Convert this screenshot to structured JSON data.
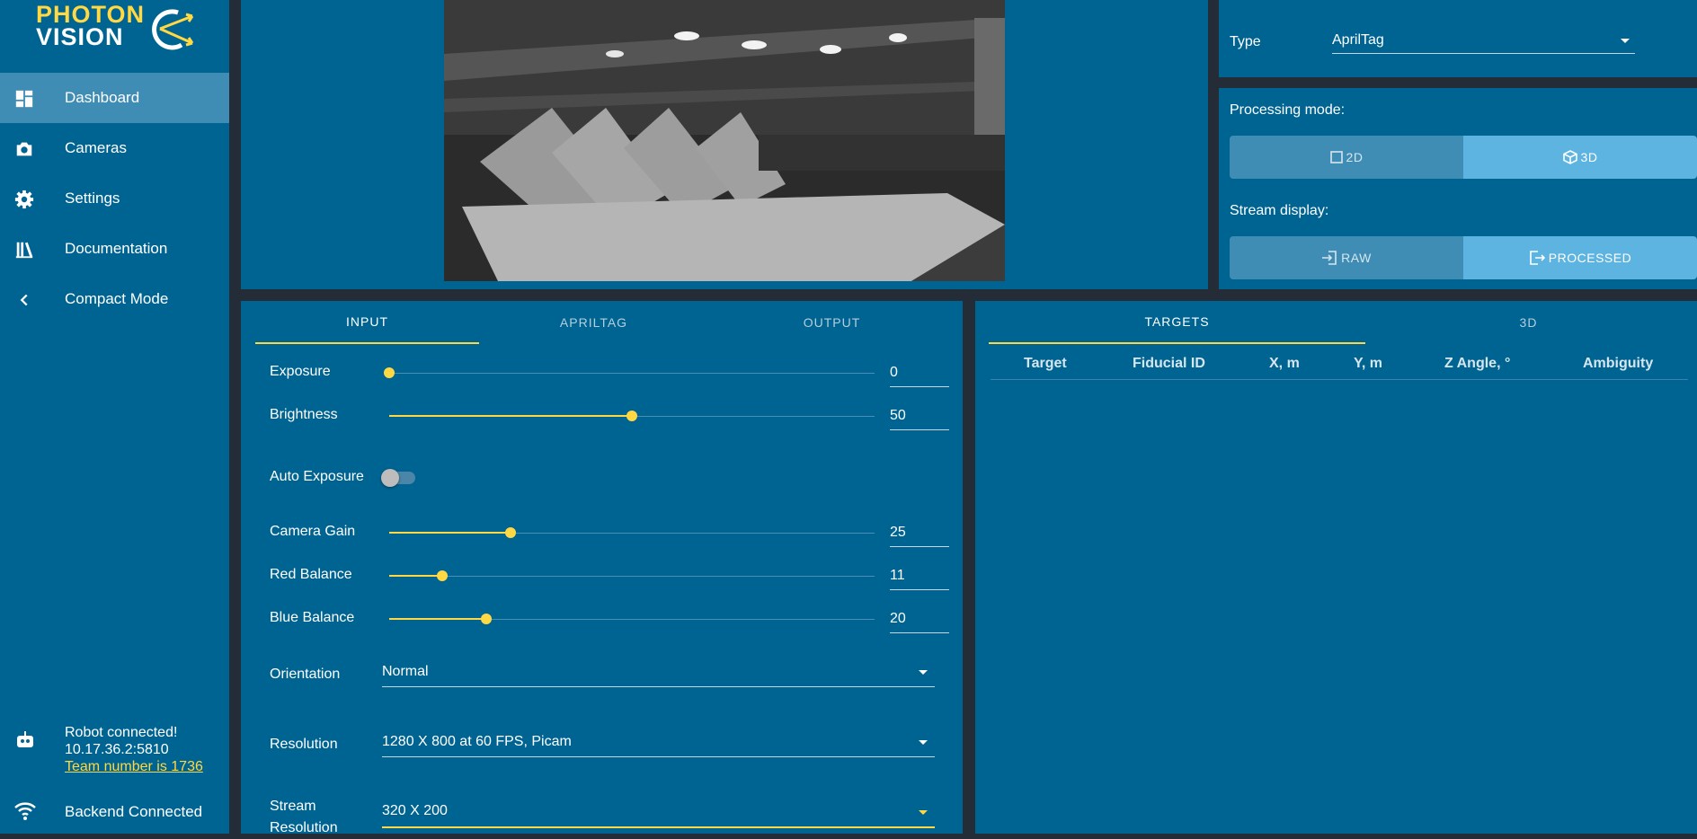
{
  "brand": {
    "line1": "PHOTON",
    "line2": "VISION"
  },
  "sidebar": {
    "items": [
      {
        "label": "Dashboard",
        "icon": "dashboard-icon",
        "active": true
      },
      {
        "label": "Cameras",
        "icon": "camera-icon"
      },
      {
        "label": "Settings",
        "icon": "gear-icon"
      },
      {
        "label": "Documentation",
        "icon": "books-icon"
      },
      {
        "label": "Compact Mode",
        "icon": "chevron-left-icon"
      }
    ],
    "robot_status": {
      "line1": "Robot connected!",
      "line2": "10.17.36.2:5810",
      "link": "Team number is 1736"
    },
    "backend_status": "Backend Connected"
  },
  "pipeline": {
    "type_label": "Type",
    "type_value": "AprilTag",
    "processing_mode_label": "Processing mode:",
    "processing_modes": [
      "2D",
      "3D"
    ],
    "processing_mode_selected": "3D",
    "stream_display_label": "Stream display:",
    "stream_displays": [
      "RAW",
      "PROCESSED"
    ],
    "stream_display_selected": "PROCESSED"
  },
  "settings_tabs": [
    "INPUT",
    "APRILTAG",
    "OUTPUT"
  ],
  "input": {
    "sliders": [
      {
        "label": "Exposure",
        "value": "0",
        "fraction": 0.0
      },
      {
        "label": "Brightness",
        "value": "50",
        "fraction": 0.5
      },
      {
        "label": "Camera Gain",
        "value": "25",
        "fraction": 0.25
      },
      {
        "label": "Red Balance",
        "value": "11",
        "fraction": 0.11
      },
      {
        "label": "Blue Balance",
        "value": "20",
        "fraction": 0.2
      }
    ],
    "auto_exposure_label": "Auto Exposure",
    "auto_exposure_on": false,
    "orientation_label": "Orientation",
    "orientation_value": "Normal",
    "resolution_label": "Resolution",
    "resolution_value": "1280 X 800 at 60 FPS, Picam",
    "stream_resolution_label_1": "Stream",
    "stream_resolution_label_2": "Resolution",
    "stream_resolution_value": "320 X 200"
  },
  "targets_tabs": [
    "TARGETS",
    "3D"
  ],
  "targets_table": {
    "columns": [
      "Target",
      "Fiducial ID",
      "X, m",
      "Y, m",
      "Z Angle, °",
      "Ambiguity"
    ],
    "rows": []
  },
  "colors": {
    "panel": "#006492",
    "accent": "#ffd843",
    "background": "#232c37"
  }
}
